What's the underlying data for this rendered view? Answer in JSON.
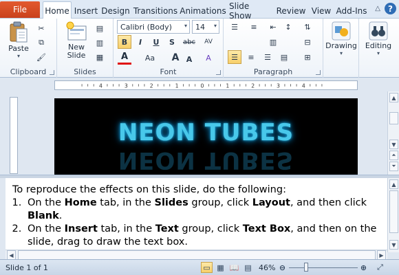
{
  "tabs": {
    "file": "File",
    "items": [
      "Home",
      "Insert",
      "Design",
      "Transitions",
      "Animations",
      "Slide Show",
      "Review",
      "View",
      "Add-Ins"
    ],
    "active": "Home",
    "help": "?"
  },
  "ribbon": {
    "clipboard": {
      "label": "Clipboard",
      "paste": "Paste"
    },
    "slides": {
      "label": "Slides",
      "new_slide": "New Slide"
    },
    "font": {
      "label": "Font",
      "font_name": "Calibri (Body)",
      "font_size": "14",
      "bold": "B",
      "italic": "I",
      "underline": "U",
      "shadow": "S",
      "strike": "abc",
      "spacing": "AV",
      "color": "A",
      "case": "Aa",
      "grow": "A",
      "shrink": "A",
      "clear": "A"
    },
    "paragraph": {
      "label": "Paragraph"
    },
    "drawing": {
      "label": "Drawing"
    },
    "editing": {
      "label": "Editing"
    }
  },
  "slide": {
    "title": "NEON TUBES"
  },
  "notes": {
    "intro": "To reproduce the effects on this slide, do the following:",
    "step1": {
      "a": "On the ",
      "b": "Home",
      "c": " tab, in the ",
      "d": "Slides",
      "e": " group, click ",
      "f": "Layout",
      "g": ", and then click ",
      "h": "Blank",
      "i": "."
    },
    "step2": {
      "a": "On the ",
      "b": "Insert",
      "c": " tab, in the ",
      "d": "Text",
      "e": " group, click ",
      "f": "Text Box",
      "g": ", and then on the slide, drag to draw the text box."
    }
  },
  "status": {
    "slide_count": "Slide 1 of 1",
    "zoom": "46%",
    "zoom_fraction": 0.46
  },
  "colors": {
    "file_tab": "#d24726",
    "neon": "#48c8ea",
    "highlight": "#f8d06a"
  }
}
